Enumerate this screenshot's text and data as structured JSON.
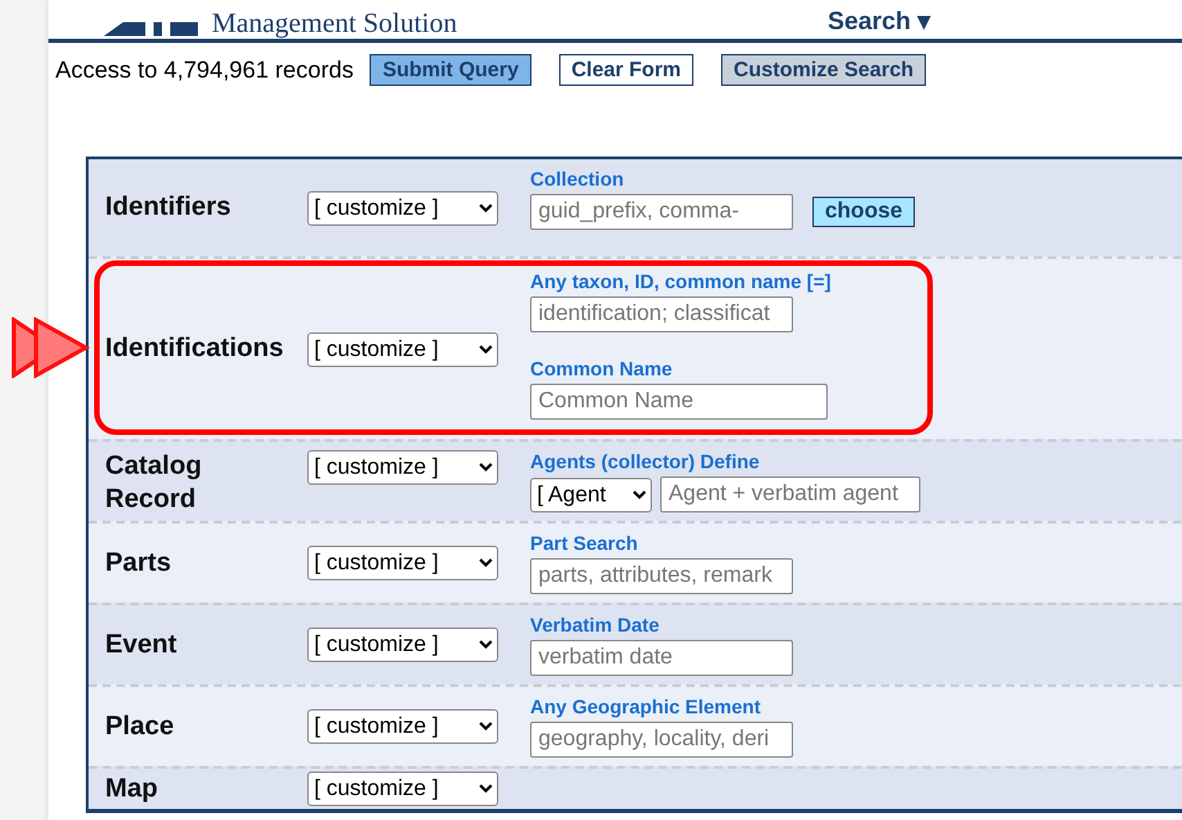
{
  "header": {
    "title": "Management Solution",
    "menu": "Search ▾"
  },
  "toolbar": {
    "record_count": "Access to 4,794,961 records",
    "buttons": [
      {
        "label": "Submit Query",
        "kind": "primary"
      },
      {
        "label": "Clear Form",
        "kind": "plain"
      },
      {
        "label": "Customize Search",
        "kind": "secondary"
      }
    ]
  },
  "sections": [
    {
      "label": "Identifiers",
      "select": "[ customize ]",
      "highlighted": false,
      "fields": [
        {
          "label": "Collection",
          "controls": [
            {
              "kind": "input",
              "placeholder": "guid_prefix, comma-"
            },
            {
              "kind": "button",
              "text": "choose"
            }
          ]
        }
      ]
    },
    {
      "label": "Identifications",
      "select": "[ customize ]",
      "highlighted": true,
      "fields": [
        {
          "label": "Any taxon, ID, common name [=]",
          "controls": [
            {
              "kind": "input",
              "placeholder": "identification; classificat"
            }
          ]
        },
        {
          "label": "Common Name",
          "controls": [
            {
              "kind": "input",
              "placeholder": "Common Name"
            }
          ]
        }
      ]
    },
    {
      "label": "Catalog Record",
      "select": "[ customize ]",
      "highlighted": false,
      "fields": [
        {
          "label": "Agents (collector) Define",
          "controls": [
            {
              "kind": "select",
              "text": "[ Agent"
            },
            {
              "kind": "input",
              "placeholder": "Agent + verbatim agent"
            }
          ]
        }
      ]
    },
    {
      "label": "Parts",
      "select": "[ customize ]",
      "highlighted": false,
      "fields": [
        {
          "label": "Part Search",
          "controls": [
            {
              "kind": "input",
              "placeholder": "parts, attributes, remark"
            }
          ]
        }
      ]
    },
    {
      "label": "Event",
      "select": "[ customize ]",
      "highlighted": false,
      "fields": [
        {
          "label": "Verbatim Date",
          "controls": [
            {
              "kind": "input",
              "placeholder": "verbatim date"
            }
          ]
        }
      ]
    },
    {
      "label": "Place",
      "select": "[ customize ]",
      "highlighted": false,
      "fields": [
        {
          "label": "Any Geographic Element",
          "controls": [
            {
              "kind": "input",
              "placeholder": "geography, locality, deri"
            }
          ]
        }
      ]
    },
    {
      "label": "Map",
      "select": "[ customize ]",
      "highlighted": false
    }
  ]
}
